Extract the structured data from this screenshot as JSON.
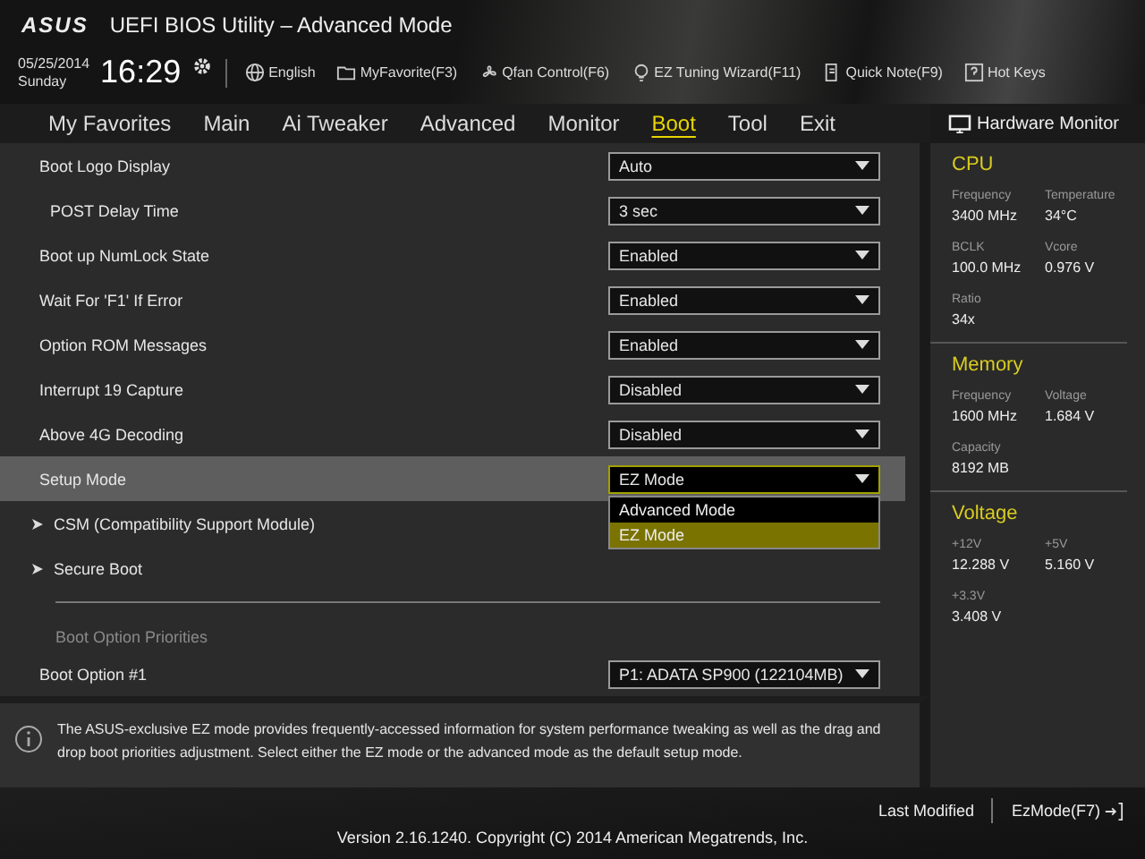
{
  "header": {
    "logo": "ASUS",
    "title": "UEFI BIOS Utility – Advanced Mode",
    "date": "05/25/2014",
    "day": "Sunday",
    "time": "16:29",
    "tools": [
      {
        "kind": "globe",
        "label": "English"
      },
      {
        "kind": "folder",
        "label": "MyFavorite(F3)"
      },
      {
        "kind": "fan",
        "label": "Qfan Control(F6)"
      },
      {
        "kind": "bulb",
        "label": "EZ Tuning Wizard(F11)"
      },
      {
        "kind": "note",
        "label": "Quick Note(F9)"
      },
      {
        "kind": "help",
        "label": "Hot Keys"
      }
    ]
  },
  "tabs": [
    {
      "label": "My Favorites",
      "selected": false
    },
    {
      "label": "Main",
      "selected": false
    },
    {
      "label": "Ai Tweaker",
      "selected": false
    },
    {
      "label": "Advanced",
      "selected": false
    },
    {
      "label": "Monitor",
      "selected": false
    },
    {
      "label": "Boot",
      "selected": true
    },
    {
      "label": "Tool",
      "selected": false
    },
    {
      "label": "Exit",
      "selected": false
    }
  ],
  "settings": [
    {
      "kind": "select",
      "label": "Boot Logo Display",
      "value": "Auto",
      "selected": false,
      "indent": false
    },
    {
      "kind": "select",
      "label": "POST Delay Time",
      "value": "3 sec",
      "selected": false,
      "indent": true
    },
    {
      "kind": "select",
      "label": "Boot up NumLock State",
      "value": "Enabled",
      "selected": false,
      "indent": false
    },
    {
      "kind": "select",
      "label": "Wait For 'F1' If Error",
      "value": "Enabled",
      "selected": false,
      "indent": false
    },
    {
      "kind": "select",
      "label": "Option ROM Messages",
      "value": "Enabled",
      "selected": false,
      "indent": false
    },
    {
      "kind": "select",
      "label": "Interrupt 19 Capture",
      "value": "Disabled",
      "selected": false,
      "indent": false
    },
    {
      "kind": "select",
      "label": "Above 4G Decoding",
      "value": "Disabled",
      "selected": false,
      "indent": false
    },
    {
      "kind": "select",
      "label": "Setup Mode",
      "value": "EZ Mode",
      "selected": true,
      "indent": false,
      "options": [
        {
          "label": "Advanced Mode",
          "selected": false
        },
        {
          "label": "EZ Mode",
          "selected": true
        }
      ]
    },
    {
      "kind": "submenu",
      "label": "CSM (Compatibility Support Module)",
      "selected": false
    },
    {
      "kind": "submenu",
      "label": "Secure Boot",
      "selected": false
    },
    {
      "kind": "header",
      "label": "Boot Option Priorities"
    },
    {
      "kind": "select",
      "label": "Boot Option #1",
      "value": "P1: ADATA SP900  (122104MB)",
      "selected": false,
      "indent": false
    }
  ],
  "help_text": "The ASUS-exclusive EZ mode provides frequently-accessed information for system performance tweaking as well as the drag and drop boot priorities adjustment. Select either the EZ mode or the advanced mode as the default setup mode.",
  "hardware_monitor": {
    "title": "Hardware Monitor",
    "sections": [
      {
        "title": "CPU",
        "items": [
          {
            "label": "Frequency",
            "value": "3400 MHz"
          },
          {
            "label": "Temperature",
            "value": "34°C"
          },
          {
            "label": "BCLK",
            "value": "100.0 MHz"
          },
          {
            "label": "Vcore",
            "value": "0.976 V"
          },
          {
            "label": "Ratio",
            "value": "34x"
          }
        ]
      },
      {
        "title": "Memory",
        "items": [
          {
            "label": "Frequency",
            "value": "1600 MHz"
          },
          {
            "label": "Voltage",
            "value": "1.684 V"
          },
          {
            "label": "Capacity",
            "value": "8192 MB"
          }
        ]
      },
      {
        "title": "Voltage",
        "items": [
          {
            "label": "+12V",
            "value": "12.288 V"
          },
          {
            "label": "+5V",
            "value": "5.160 V"
          },
          {
            "label": "+3.3V",
            "value": "3.408 V"
          }
        ]
      }
    ]
  },
  "footer": {
    "last_modified": "Last Modified",
    "ez_mode": "EzMode(F7)",
    "version": "Version 2.16.1240. Copyright (C) 2014 American Megatrends, Inc."
  }
}
